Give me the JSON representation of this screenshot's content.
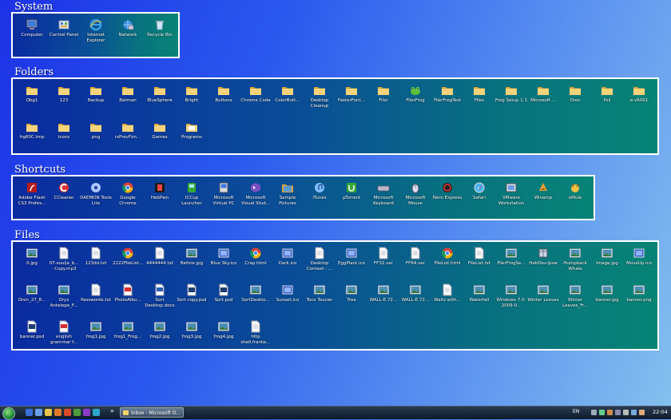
{
  "sections": {
    "system": {
      "title": "System",
      "items": [
        {
          "label": "Computer",
          "icon": "computer-icon"
        },
        {
          "label": "Control Panel",
          "icon": "control-panel-icon"
        },
        {
          "label": "Internet Explorer",
          "icon": "internet-explorer-icon"
        },
        {
          "label": "Network",
          "icon": "network-icon"
        },
        {
          "label": "Recycle Bin",
          "icon": "recycle-bin-icon"
        }
      ]
    },
    "folders": {
      "title": "Folders",
      "items": [
        {
          "label": "Obg1",
          "icon": "folder-icon"
        },
        {
          "label": "123",
          "icon": "folder-icon"
        },
        {
          "label": "Backup",
          "icon": "folder-icon"
        },
        {
          "label": "Batman",
          "icon": "folder-icon"
        },
        {
          "label": "BlueSphere",
          "icon": "folder-icon"
        },
        {
          "label": "Bright",
          "icon": "folder-icon"
        },
        {
          "label": "Buttons",
          "icon": "folder-icon"
        },
        {
          "label": "Chrome Code",
          "icon": "folder-icon"
        },
        {
          "label": "ColorButt...",
          "icon": "folder-icon"
        },
        {
          "label": "Desktop Cleanup",
          "icon": "folder-icon"
        },
        {
          "label": "FasterFont...",
          "icon": "folder-icon"
        },
        {
          "label": "Filer",
          "icon": "folder-icon"
        },
        {
          "label": "FilerFrog",
          "icon": "frog-icon"
        },
        {
          "label": "FilerFrogTest",
          "icon": "folder-icon"
        },
        {
          "label": "Files",
          "icon": "folder-icon"
        },
        {
          "label": "Frog Setup 1.1",
          "icon": "folder-icon"
        },
        {
          "label": "Microsoft....",
          "icon": "folder-icon"
        },
        {
          "label": "Oren",
          "icon": "folder-icon"
        },
        {
          "label": "Psil",
          "icon": "folder-icon"
        },
        {
          "label": "e-v6001",
          "icon": "folder-icon"
        },
        {
          "label": "frg60C.tmp",
          "icon": "folder-icon"
        },
        {
          "label": "icons",
          "icon": "folder-icon"
        },
        {
          "label": "png",
          "icon": "folder-icon"
        },
        {
          "label": "rsPrevFon...",
          "icon": "folder-icon"
        },
        {
          "label": "Games",
          "icon": "folder-icon"
        },
        {
          "label": "Programs",
          "icon": "programs-folder-icon"
        }
      ]
    },
    "shortcuts": {
      "title": "Shortcuts",
      "items": [
        {
          "label": "Adobe Flash CS3 Profes...",
          "icon": "adobe-flash-icon"
        },
        {
          "label": "CCleaner",
          "icon": "ccleaner-icon"
        },
        {
          "label": "DAEMON Tools Lite",
          "icon": "daemon-tools-icon"
        },
        {
          "label": "Google Chrome",
          "icon": "chrome-icon"
        },
        {
          "label": "HebPwn",
          "icon": "hebpwn-icon"
        },
        {
          "label": "ICCup Launcher",
          "icon": "iccup-icon"
        },
        {
          "label": "Microsoft Virtual PC",
          "icon": "virtual-pc-icon"
        },
        {
          "label": "Microsoft Visual Stud...",
          "icon": "visual-studio-icon"
        },
        {
          "label": "Sample Pictures",
          "icon": "sample-pictures-icon"
        },
        {
          "label": "iTunes",
          "icon": "itunes-icon"
        },
        {
          "label": "µTorrent",
          "icon": "utorrent-icon"
        },
        {
          "label": "Microsoft Keyboard",
          "icon": "keyboard-icon"
        },
        {
          "label": "Microsoft Mouse",
          "icon": "mouse-icon"
        },
        {
          "label": "Nero Express",
          "icon": "nero-icon"
        },
        {
          "label": "Safari",
          "icon": "safari-icon"
        },
        {
          "label": "VMware Workstation",
          "icon": "vmware-icon"
        },
        {
          "label": "Winamp",
          "icon": "winamp-icon"
        },
        {
          "label": "eMule",
          "icon": "emule-icon"
        }
      ]
    },
    "files": {
      "title": "Files",
      "items": [
        {
          "label": "0.jpg",
          "icon": "image-file-icon"
        },
        {
          "label": "07-soulja_b... - Copy.mp3",
          "icon": "audio-file-icon"
        },
        {
          "label": "123dd.txt",
          "icon": "text-file-icon"
        },
        {
          "label": "2222FileList...",
          "icon": "chrome-html-icon"
        },
        {
          "label": "4444444.txt",
          "icon": "text-file-icon"
        },
        {
          "label": "Before.jpg",
          "icon": "image-file-icon"
        },
        {
          "label": "Blue Sky.ico",
          "icon": "ico-file-icon"
        },
        {
          "label": "Crap.html",
          "icon": "chrome-html-icon"
        },
        {
          "label": "Dark.ico",
          "icon": "ico-file-icon"
        },
        {
          "label": "Desktop Context - ...",
          "icon": "shortcut-file-icon"
        },
        {
          "label": "EggPlant.ico",
          "icon": "ico-file-icon"
        },
        {
          "label": "FF32.ver",
          "icon": "generic-file-icon"
        },
        {
          "label": "FF64.ver",
          "icon": "generic-file-icon"
        },
        {
          "label": "FileList.html",
          "icon": "chrome-html-icon"
        },
        {
          "label": "FileList.txt",
          "icon": "text-file-icon"
        },
        {
          "label": "FilerFrogSe...",
          "icon": "image-file-icon"
        },
        {
          "label": "HebDev.ipsw",
          "icon": "package-file-icon"
        },
        {
          "label": "Humpback Whale",
          "icon": "image-file-icon"
        },
        {
          "label": "Image.jpg",
          "icon": "image-file-icon"
        },
        {
          "label": "MoveUp.ico",
          "icon": "ico-file-icon"
        },
        {
          "label": "Oren_27_8...",
          "icon": "image-file-icon"
        },
        {
          "label": "Oryx Antelope_F...",
          "icon": "image-file-icon"
        },
        {
          "label": "Passwords.txt",
          "icon": "text-file-icon"
        },
        {
          "label": "PhotoAlbu...",
          "icon": "pdf-file-icon"
        },
        {
          "label": "Sort Desktop.docx",
          "icon": "word-file-icon"
        },
        {
          "label": "Sort copy.psd",
          "icon": "psd-file-icon"
        },
        {
          "label": "Sort.psd",
          "icon": "psd-file-icon"
        },
        {
          "label": "SortDeskto...",
          "icon": "image-file-icon"
        },
        {
          "label": "Sunset.ico",
          "icon": "ico-file-icon"
        },
        {
          "label": "Toco Toucan",
          "icon": "image-file-icon"
        },
        {
          "label": "Tree",
          "icon": "image-file-icon"
        },
        {
          "label": "WALL-E.72...",
          "icon": "image-file-icon"
        },
        {
          "label": "WALL-E.72...",
          "icon": "image-file-icon"
        },
        {
          "label": "Waltz.with...",
          "icon": "text-file-icon"
        },
        {
          "label": "Waterfall",
          "icon": "image-file-icon"
        },
        {
          "label": "Windows 7.0-2009-0...",
          "icon": "image-file-icon"
        },
        {
          "label": "Winter Leaves",
          "icon": "image-file-icon"
        },
        {
          "label": "Winter Leaves_Fr...",
          "icon": "image-file-icon"
        },
        {
          "label": "banner.jpg",
          "icon": "image-file-icon"
        },
        {
          "label": "banner.png",
          "icon": "image-file-icon"
        },
        {
          "label": "banner.psd",
          "icon": "psd-file-icon"
        },
        {
          "label": "english grammar f...",
          "icon": "pdf-file-icon"
        },
        {
          "label": "frog1.jpg",
          "icon": "image-file-icon"
        },
        {
          "label": "frog1_Frog...",
          "icon": "image-file-icon"
        },
        {
          "label": "frog2.jpg",
          "icon": "image-file-icon"
        },
        {
          "label": "frog3.jpg",
          "icon": "image-file-icon"
        },
        {
          "label": "frog4.jpg",
          "icon": "image-file-icon"
        },
        {
          "label": "http shell.franke...",
          "icon": "url-file-icon"
        }
      ]
    }
  },
  "taskbar": {
    "task_label": "Inbox - Microsoft O...",
    "language": "EN",
    "clock": "22:04",
    "overflow_chevron": "»"
  },
  "colors": {
    "fence_start": "#0a2ba0",
    "fence_end": "#078476",
    "fence_border": "#ffffff",
    "desktop_start": "#1d33e6",
    "desktop_end": "#86c0ee"
  }
}
